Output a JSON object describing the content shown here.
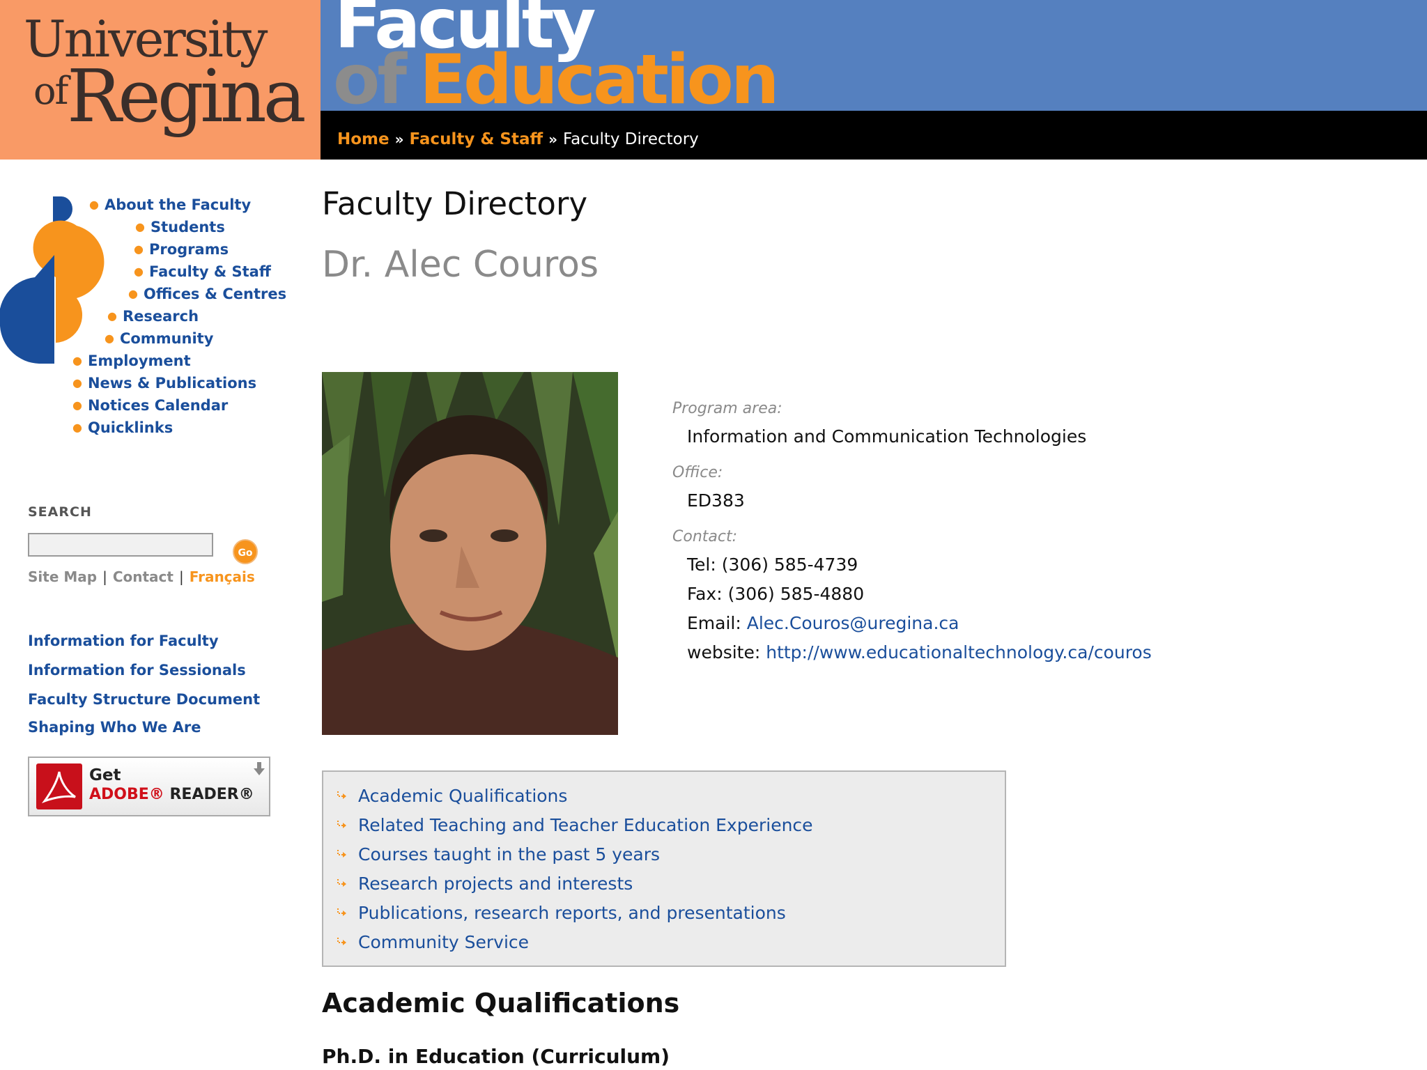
{
  "header": {
    "logo": {
      "line1": "University",
      "line2_small": "of",
      "line2_large": "Regina"
    },
    "banner": {
      "line1": "Faculty",
      "line2_of": "of",
      "line2_main": "Education"
    },
    "breadcrumb": [
      {
        "label": "Home"
      },
      {
        "label": "Faculty & Staff"
      },
      {
        "label": "Faculty Directory"
      }
    ],
    "breadcrumb_separator": "»"
  },
  "sidebar": {
    "nav": [
      {
        "label": "About the Faculty"
      },
      {
        "label": "Students"
      },
      {
        "label": "Programs"
      },
      {
        "label": "Faculty & Staff"
      },
      {
        "label": "Offices & Centres"
      },
      {
        "label": "Research"
      },
      {
        "label": "Community"
      },
      {
        "label": "Employment"
      },
      {
        "label": "News & Publications"
      },
      {
        "label": "Notices Calendar"
      },
      {
        "label": "Quicklinks"
      }
    ],
    "search": {
      "label": "SEARCH",
      "placeholder": "",
      "go_label": "Go"
    },
    "utility_links": [
      {
        "label": "Site Map"
      },
      {
        "label": "Contact"
      },
      {
        "label": "Français"
      }
    ],
    "utility_separator": "|",
    "info_links": [
      {
        "label": "Information for Faculty"
      },
      {
        "label": "Information for Sessionals"
      },
      {
        "label": "Faculty Structure Document"
      },
      {
        "label": "Shaping Who We Are"
      }
    ],
    "adobe_badge": {
      "get": "Get",
      "brand": "ADOBE®",
      "product": "READER®"
    }
  },
  "main": {
    "title": "Faculty Directory",
    "name": "Dr. Alec Couros",
    "program_area": {
      "label": "Program area:",
      "value": "Information and Communication Technologies"
    },
    "office": {
      "label": "Office:",
      "value": "ED383"
    },
    "contact": {
      "label": "Contact:",
      "tel_label": "Tel:",
      "tel": "(306) 585-4739",
      "fax_label": "Fax:",
      "fax": "(306) 585-4880",
      "email_label": "Email:",
      "email": "Alec.Couros@uregina.ca",
      "website_label": "website:",
      "website": "http://www.educationaltechnology.ca/couros"
    },
    "toc": [
      {
        "label": "Academic Qualifications"
      },
      {
        "label": "Related Teaching and Teacher Education Experience"
      },
      {
        "label": "Courses taught in the past 5 years"
      },
      {
        "label": "Research projects and interests"
      },
      {
        "label": "Publications, research reports, and presentations"
      },
      {
        "label": "Community Service"
      }
    ],
    "section_heading": "Academic Qualifications",
    "degree": "Ph.D. in Education (Curriculum)"
  },
  "colors": {
    "logo_bg": "#f99a66",
    "banner_bg": "#5580bf",
    "breadcrumb_bg": "#000000",
    "accent_orange": "#f7941d",
    "link_blue": "#1a4e9b",
    "muted_gray": "#8a8a8a"
  }
}
